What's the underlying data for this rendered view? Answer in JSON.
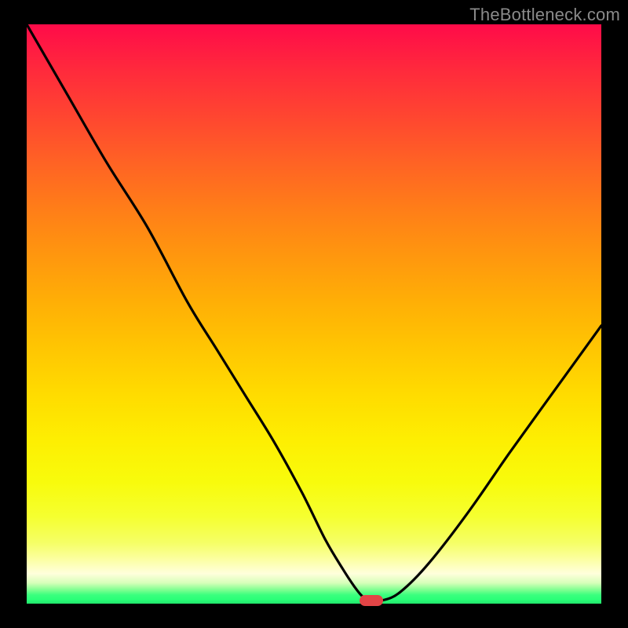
{
  "watermark": "TheBottleneck.com",
  "chart_data": {
    "type": "line",
    "title": "",
    "xlabel": "",
    "ylabel": "",
    "xlim": [
      0,
      100
    ],
    "ylim": [
      0,
      100
    ],
    "grid": false,
    "legend": false,
    "colors": {
      "gradient_top": "#ff0b49",
      "gradient_mid": "#ffdc00",
      "gradient_bottom": "#22e56b",
      "curve": "#000000",
      "indicator": "#e24446",
      "background": "#000000",
      "watermark": "#8a8a8a"
    },
    "series": [
      {
        "name": "bottleneck-curve",
        "x": [
          0,
          7,
          14,
          21,
          28,
          33,
          38,
          43,
          48,
          52,
          55,
          57,
          58.5,
          60,
          62,
          65,
          70,
          77,
          84,
          92,
          100
        ],
        "y": [
          100,
          88,
          76,
          65,
          52,
          44,
          36,
          28,
          19,
          11,
          6,
          3,
          1.2,
          0.7,
          0.6,
          2,
          7,
          16,
          26,
          37,
          48
        ]
      }
    ],
    "optimal_point": {
      "x": 60,
      "y": 0.6
    }
  }
}
